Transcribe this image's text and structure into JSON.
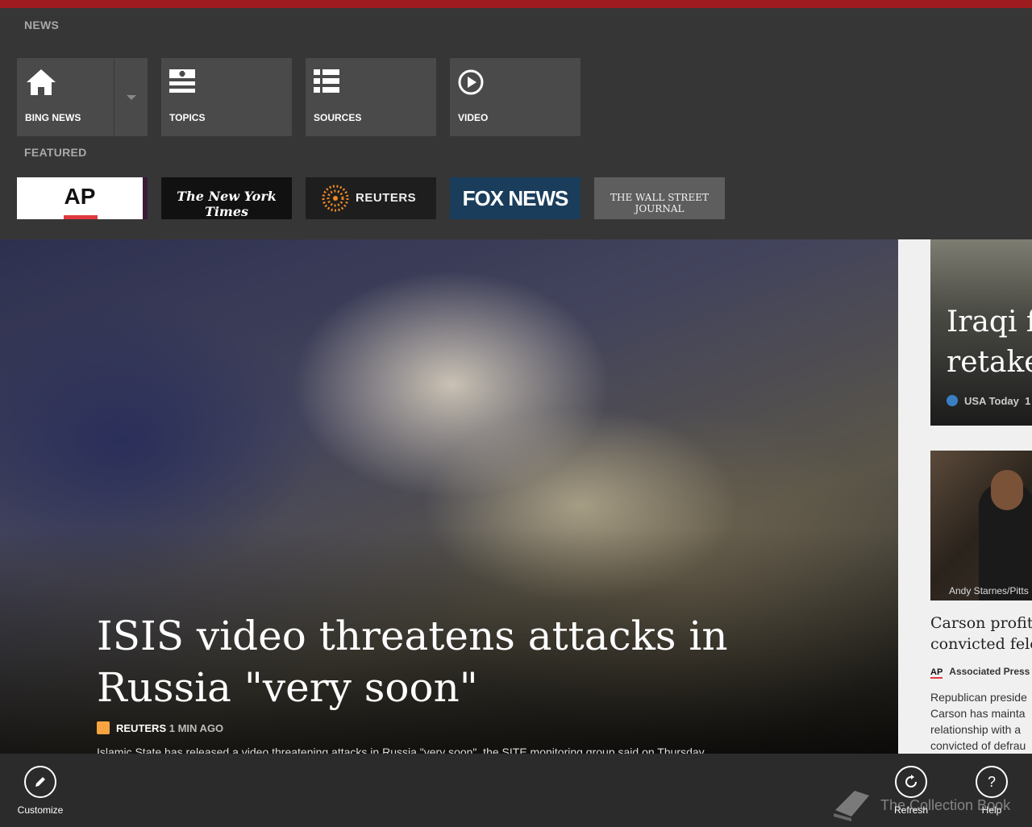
{
  "app": {
    "accent": "#9e1b20",
    "section_news": "NEWS",
    "section_featured": "FEATURED"
  },
  "nav_tiles": [
    {
      "label": "BING NEWS",
      "icon": "home-icon"
    },
    {
      "label": "TOPICS",
      "icon": "topics-icon"
    },
    {
      "label": "SOURCES",
      "icon": "list-icon"
    },
    {
      "label": "VIDEO",
      "icon": "play-icon"
    }
  ],
  "featured_sources": [
    {
      "name": "AP"
    },
    {
      "name": "The New York Times"
    },
    {
      "name": "REUTERS"
    },
    {
      "name": "FOX NEWS"
    },
    {
      "name": "THE WALL STREET JOURNAL"
    }
  ],
  "hero": {
    "title": "ISIS video threatens attacks in Russia \"very soon\"",
    "source": "REUTERS",
    "time": "1 MIN AGO",
    "summary": "Islamic State has released a video threatening attacks in Russia \"very soon\", the SITE monitoring group said on Thursday."
  },
  "side_card_1": {
    "title_line1": "Iraqi f",
    "title_line2": "retake",
    "source": "USA Today",
    "time": "1"
  },
  "side_card_2": {
    "credit": "Andy Starnes/Pitts",
    "title_line1": "Carson profit",
    "title_line2": "convicted felo",
    "source_logo": "AP",
    "source": "Associated Press",
    "body": [
      "Republican preside",
      "Carson has mainta",
      "relationship with a",
      "convicted of defrau"
    ]
  },
  "appbar": {
    "customize": "Customize",
    "refresh": "Refresh",
    "help": "Help"
  },
  "watermark": "The Collection Book"
}
